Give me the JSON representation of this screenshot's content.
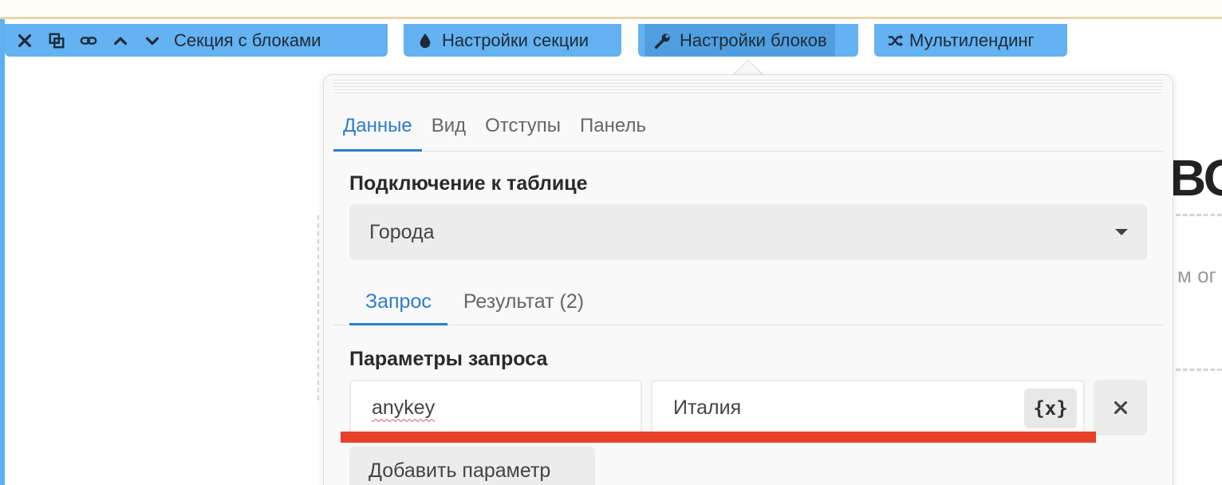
{
  "toolbar": {
    "section_label": "Секция с блоками",
    "section_settings_label": "Настройки секции",
    "block_settings_label": "Настройки блоков",
    "multilanding_label": "Мультилендинг"
  },
  "panel": {
    "tabs": [
      {
        "label": "Данные"
      },
      {
        "label": "Вид"
      },
      {
        "label": "Отступы"
      },
      {
        "label": "Панель"
      }
    ],
    "table_connection_label": "Подключение к таблице",
    "table_select_value": "Города",
    "subtabs": [
      {
        "label": "Запрос"
      },
      {
        "label": "Результат (2)"
      }
    ],
    "query_params_label": "Параметры запроса",
    "param_key_value": "anykey",
    "param_value_value": "Италия",
    "variable_button_label": "{x}",
    "add_param_label": "Добавить параметр"
  },
  "background": {
    "big_text": "ВО",
    "small_text": "м ог"
  },
  "colors": {
    "toolbar_bg": "#64b2f2",
    "active_tab": "#2f7cc8",
    "annotation_red": "#e8412a"
  }
}
